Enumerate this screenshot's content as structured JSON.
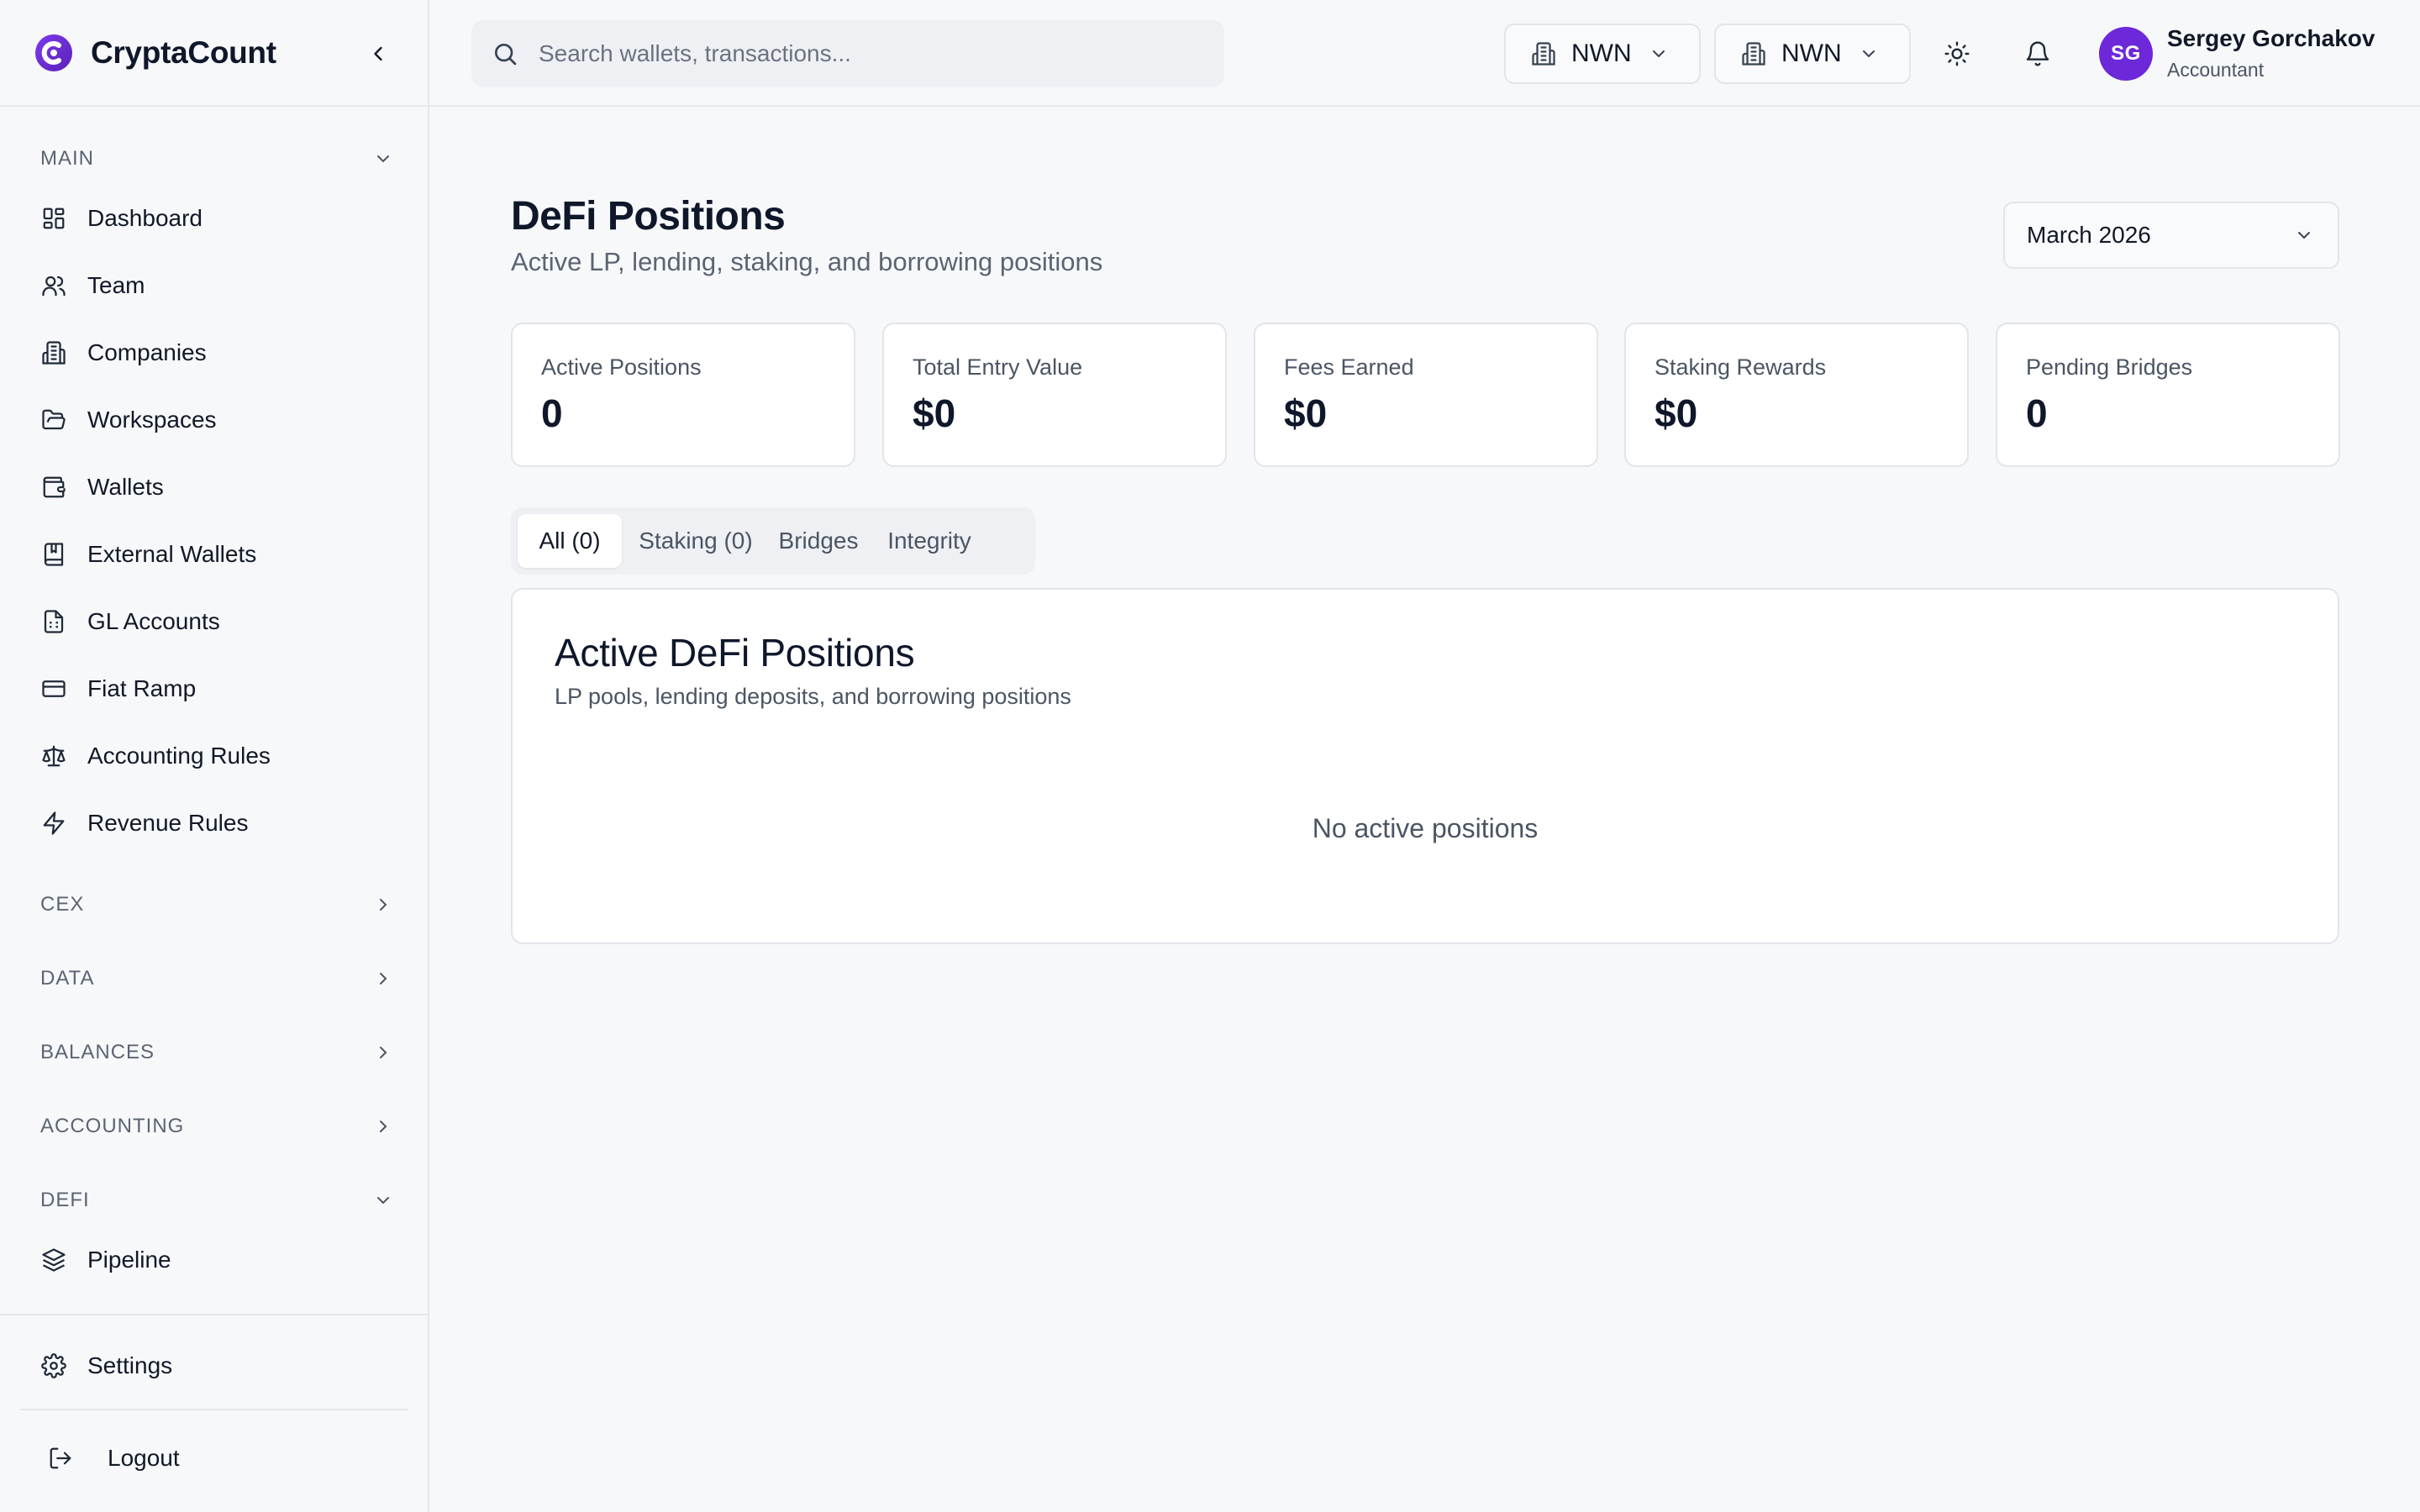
{
  "app": {
    "name": "CryptaCount",
    "brand_color": "#6d28d9"
  },
  "sidebar": {
    "sections": {
      "main": "MAIN",
      "cex": "CEX",
      "data": "DATA",
      "balances": "BALANCES",
      "accounting": "ACCOUNTING",
      "defi": "DEFI"
    },
    "main_items": [
      {
        "label": "Dashboard",
        "icon": "dashboard-icon"
      },
      {
        "label": "Team",
        "icon": "users-icon"
      },
      {
        "label": "Companies",
        "icon": "building-icon"
      },
      {
        "label": "Workspaces",
        "icon": "folder-open-icon"
      },
      {
        "label": "Wallets",
        "icon": "wallet-icon"
      },
      {
        "label": "External Wallets",
        "icon": "book-icon"
      },
      {
        "label": "GL Accounts",
        "icon": "file-spreadsheet-icon"
      },
      {
        "label": "Fiat Ramp",
        "icon": "credit-card-icon"
      },
      {
        "label": "Accounting Rules",
        "icon": "scale-icon"
      },
      {
        "label": "Revenue Rules",
        "icon": "zap-icon"
      }
    ],
    "defi_items": [
      {
        "label": "Pipeline",
        "icon": "layers-icon"
      }
    ],
    "settings": "Settings",
    "logout": "Logout"
  },
  "topbar": {
    "search_placeholder": "Search wallets, transactions...",
    "org_selector_1": "NWN",
    "org_selector_2": "NWN",
    "user": {
      "initials": "SG",
      "name": "Sergey Gorchakov",
      "role": "Accountant"
    }
  },
  "page": {
    "title": "DeFi Positions",
    "subtitle": "Active LP, lending, staking, and borrowing positions",
    "period": "March 2026"
  },
  "stats": [
    {
      "label": "Active Positions",
      "value": "0"
    },
    {
      "label": "Total Entry Value",
      "value": "$0"
    },
    {
      "label": "Fees Earned",
      "value": "$0"
    },
    {
      "label": "Staking Rewards",
      "value": "$0"
    },
    {
      "label": "Pending Bridges",
      "value": "0"
    }
  ],
  "tabs": [
    {
      "label": "All (0)",
      "active": true
    },
    {
      "label": "Staking (0)",
      "active": false
    },
    {
      "label": "Bridges",
      "active": false
    },
    {
      "label": "Integrity",
      "active": false
    }
  ],
  "panel": {
    "title": "Active DeFi Positions",
    "subtitle": "LP pools, lending deposits, and borrowing positions",
    "empty_text": "No active positions"
  }
}
